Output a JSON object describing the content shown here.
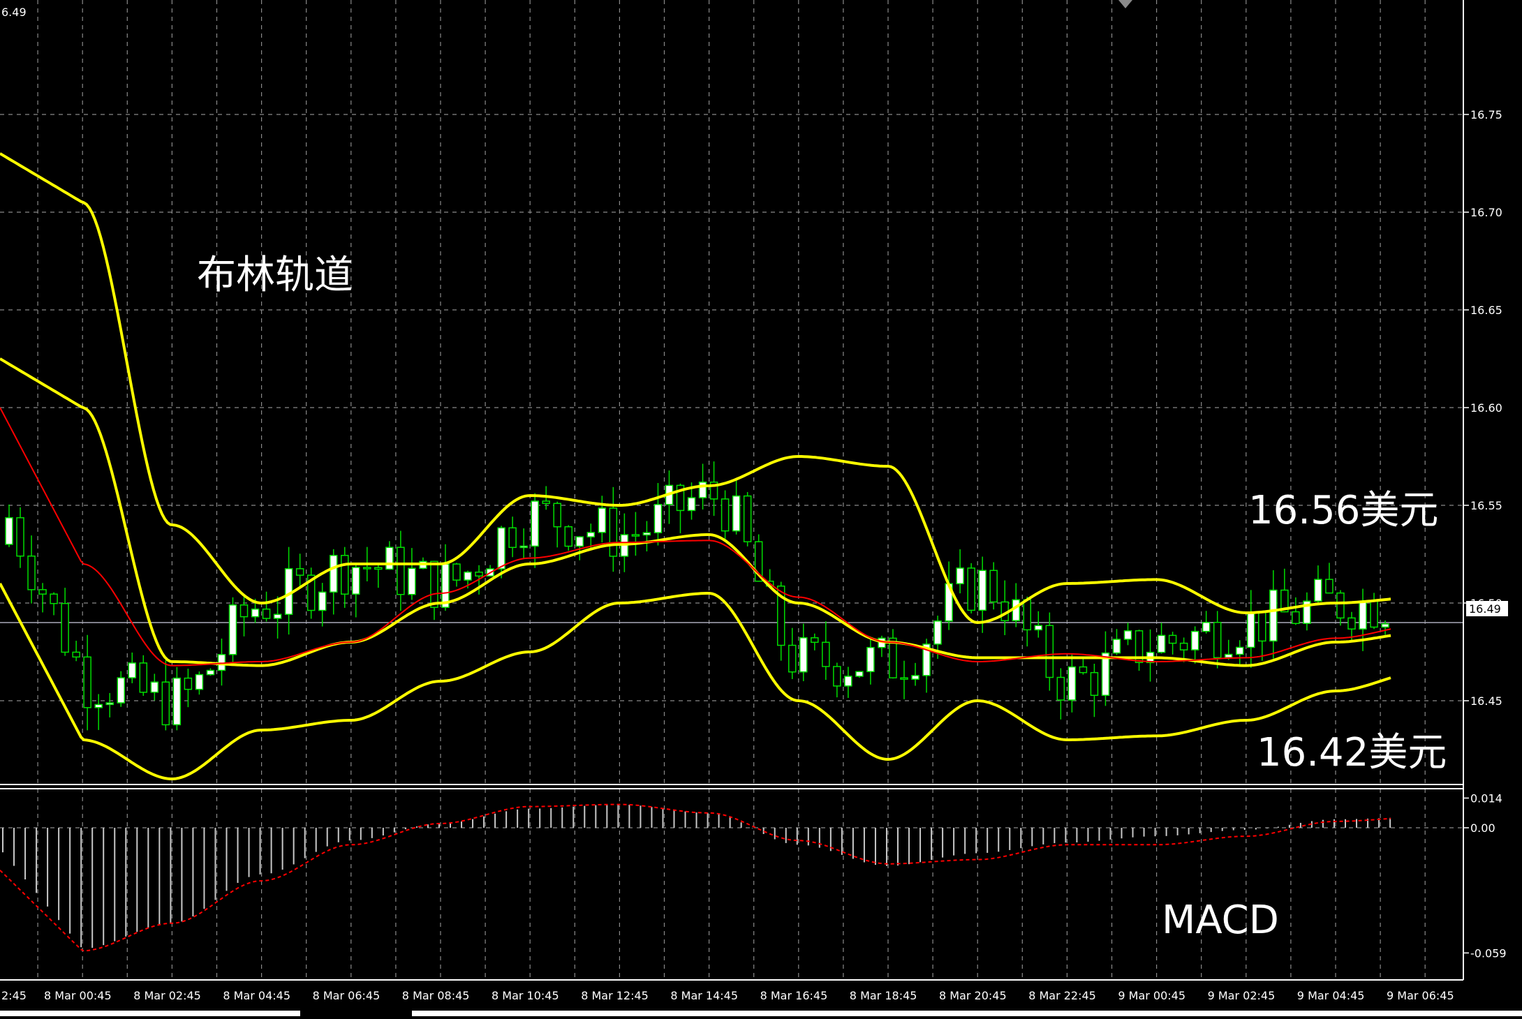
{
  "chart": {
    "price_axis_top_label": "6.49",
    "current_price_tag": "16.49",
    "price_ticks": [
      "16.75",
      "16.70",
      "16.65",
      "16.60",
      "16.55",
      "16.50",
      "16.45"
    ],
    "macd_ticks": [
      "0.014",
      "0.00",
      "-0.059"
    ],
    "time_ticks": [
      "2:45",
      "8 Mar 00:45",
      "8 Mar 02:45",
      "8 Mar 04:45",
      "8 Mar 06:45",
      "8 Mar 08:45",
      "8 Mar 10:45",
      "8 Mar 12:45",
      "8 Mar 14:45",
      "8 Mar 16:45",
      "8 Mar 18:45",
      "8 Mar 20:45",
      "8 Mar 22:45",
      "9 Mar 00:45",
      "9 Mar 02:45",
      "9 Mar 04:45",
      "9 Mar 06:45"
    ],
    "annotations": {
      "bollinger_label": "布林轨道",
      "upper_price_label": "16.56美元",
      "lower_price_label": "16.42美元",
      "macd_label": "MACD"
    },
    "colors": {
      "background": "#000000",
      "grid": "#8a8a8a",
      "candle_up": "#ffffff",
      "candle_down": "#000000",
      "candle_wick": "#00dd00",
      "bollinger": "#ffff00",
      "ma_red": "#ff0000",
      "macd_histogram": "#c8c8c8",
      "macd_signal": "#ff0000",
      "text": "#ffffff"
    }
  },
  "chart_data": [
    {
      "type": "candlestick",
      "title": "",
      "indicators": [
        "Bollinger Bands",
        "Moving Average"
      ],
      "ylim": [
        16.405,
        16.8
      ],
      "x": [
        "8 Mar 00:45",
        "8 Mar 02:45",
        "8 Mar 04:45",
        "8 Mar 06:45",
        "8 Mar 08:45",
        "8 Mar 10:45",
        "8 Mar 12:45",
        "8 Mar 14:45",
        "8 Mar 16:45",
        "8 Mar 18:45",
        "8 Mar 20:45",
        "8 Mar 22:45",
        "9 Mar 00:45",
        "9 Mar 02:45",
        "9 Mar 04:45",
        "9 Mar 06:45"
      ],
      "current_price": 16.49,
      "bollinger_upper": [
        16.705,
        16.54,
        16.5,
        16.52,
        16.52,
        16.555,
        16.55,
        16.56,
        16.575,
        16.57,
        16.49,
        16.51,
        16.512,
        16.495,
        16.5,
        16.503
      ],
      "bollinger_middle": [
        16.6,
        16.47,
        16.468,
        16.48,
        16.5,
        16.52,
        16.53,
        16.535,
        16.5,
        16.48,
        16.472,
        16.472,
        16.472,
        16.468,
        16.48,
        16.485
      ],
      "bollinger_lower": [
        16.43,
        16.41,
        16.435,
        16.44,
        16.46,
        16.475,
        16.5,
        16.505,
        16.45,
        16.42,
        16.45,
        16.43,
        16.432,
        16.44,
        16.455,
        16.465
      ],
      "moving_average": [
        16.52,
        16.468,
        16.47,
        16.48,
        16.505,
        16.523,
        16.531,
        16.532,
        16.503,
        16.48,
        16.47,
        16.474,
        16.47,
        16.472,
        16.482,
        16.489
      ],
      "price_series": [
        16.46,
        16.45,
        16.5,
        16.52,
        16.51,
        16.545,
        16.535,
        16.555,
        16.47,
        16.47,
        16.51,
        16.46,
        16.48,
        16.49,
        16.5,
        16.5
      ]
    },
    {
      "type": "bar",
      "title": "MACD",
      "ylim": [
        -0.059,
        0.014
      ],
      "x": [
        "8 Mar 00:45",
        "8 Mar 02:45",
        "8 Mar 04:45",
        "8 Mar 06:45",
        "8 Mar 08:45",
        "8 Mar 10:45",
        "8 Mar 12:45",
        "8 Mar 14:45",
        "8 Mar 16:45",
        "8 Mar 18:45",
        "8 Mar 20:45",
        "8 Mar 22:45",
        "9 Mar 00:45",
        "9 Mar 02:45",
        "9 Mar 04:45",
        "9 Mar 06:45"
      ],
      "histogram": [
        -0.057,
        -0.045,
        -0.022,
        -0.006,
        0.002,
        0.009,
        0.011,
        0.007,
        -0.008,
        -0.018,
        -0.012,
        -0.007,
        -0.004,
        -0.001,
        0.004,
        0.005
      ],
      "signal": [
        -0.058,
        -0.045,
        -0.025,
        -0.008,
        0.002,
        0.01,
        0.011,
        0.007,
        -0.006,
        -0.017,
        -0.015,
        -0.008,
        -0.008,
        -0.004,
        0.003,
        0.005
      ]
    }
  ]
}
